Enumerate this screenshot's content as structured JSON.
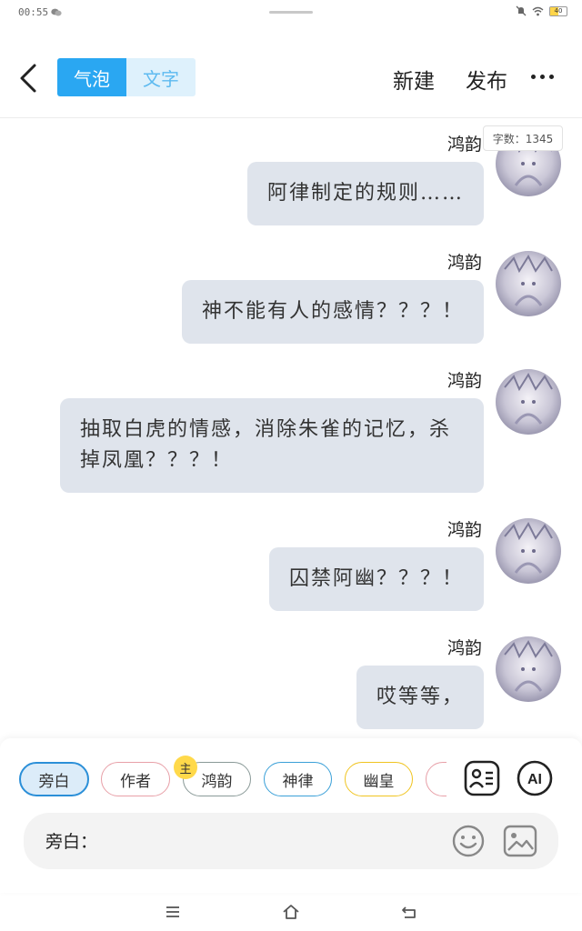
{
  "status_bar": {
    "time": "00:55",
    "battery": "40"
  },
  "toolbar": {
    "tab_bubble": "气泡",
    "tab_text": "文字",
    "new_label": "新建",
    "publish_label": "发布"
  },
  "word_count": "字数：1345",
  "messages": [
    {
      "name": "鸿韵",
      "text": "阿律制定的规则……"
    },
    {
      "name": "鸿韵",
      "text": "神不能有人的感情？？？！"
    },
    {
      "name": "鸿韵",
      "text": "抽取白虎的情感，消除朱雀的记忆，杀掉凤凰？？？！"
    },
    {
      "name": "鸿韵",
      "text": "囚禁阿幽？？？！"
    },
    {
      "name": "鸿韵",
      "text": "哎等等，"
    }
  ],
  "roles": [
    {
      "label": "旁白",
      "color": "#2b8fd8"
    },
    {
      "label": "作者",
      "color": "#e8a0a8"
    },
    {
      "label": "鸿韵",
      "color": "#8a9a98"
    },
    {
      "label": "神律",
      "color": "#3aa0d8"
    },
    {
      "label": "幽皇",
      "color": "#f0c420"
    },
    {
      "label": "",
      "color": "#e8a0a8"
    }
  ],
  "main_badge": "主",
  "input": {
    "prefix": "旁白：",
    "placeholder": ""
  },
  "accent_color": "#2aa7f2",
  "bubble_color": "#dfe4ec"
}
